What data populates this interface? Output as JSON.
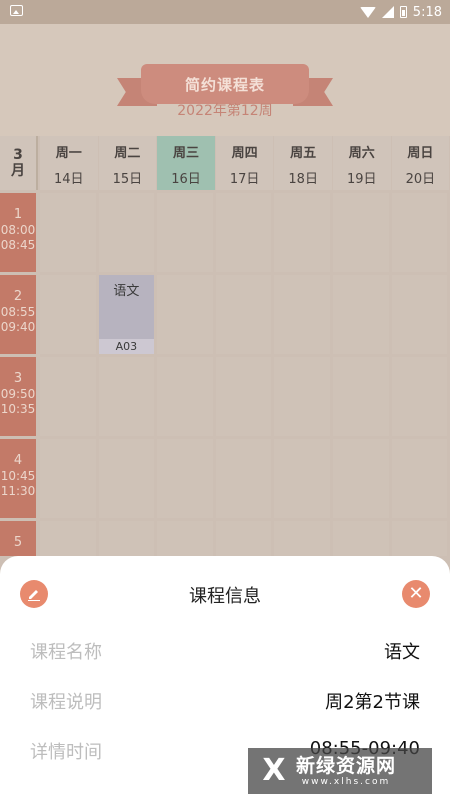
{
  "status_bar": {
    "time": "5:18"
  },
  "header": {
    "banner_title": "简约课程表",
    "week_title": "2022年第12周"
  },
  "month": {
    "number": "3",
    "unit": "月"
  },
  "days": [
    {
      "week": "周一",
      "date": "14日",
      "today": false
    },
    {
      "week": "周二",
      "date": "15日",
      "today": false
    },
    {
      "week": "周三",
      "date": "16日",
      "today": true
    },
    {
      "week": "周四",
      "date": "17日",
      "today": false
    },
    {
      "week": "周五",
      "date": "18日",
      "today": false
    },
    {
      "week": "周六",
      "date": "19日",
      "today": false
    },
    {
      "week": "周日",
      "date": "20日",
      "today": false
    }
  ],
  "periods": [
    {
      "num": "1",
      "start": "08:00",
      "end": "08:45"
    },
    {
      "num": "2",
      "start": "08:55",
      "end": "09:40"
    },
    {
      "num": "3",
      "start": "09:50",
      "end": "10:35"
    },
    {
      "num": "4",
      "start": "10:45",
      "end": "11:30"
    },
    {
      "num": "5",
      "start": "",
      "end": ""
    }
  ],
  "course": {
    "name": "语文",
    "room": "A03",
    "day": 2,
    "period": 2
  },
  "sheet": {
    "title": "课程信息",
    "rows": [
      {
        "label": "课程名称",
        "value": "语文"
      },
      {
        "label": "课程说明",
        "value": "周2第2节课"
      },
      {
        "label": "详情时间",
        "value": "08:55-09:40"
      }
    ]
  },
  "watermark": {
    "name": "新绿资源网",
    "url": "www.xlhs.com"
  },
  "colors": {
    "accent": "#e88a6e",
    "period_bg": "#c37a68",
    "today_bg": "#9fc0b0"
  }
}
